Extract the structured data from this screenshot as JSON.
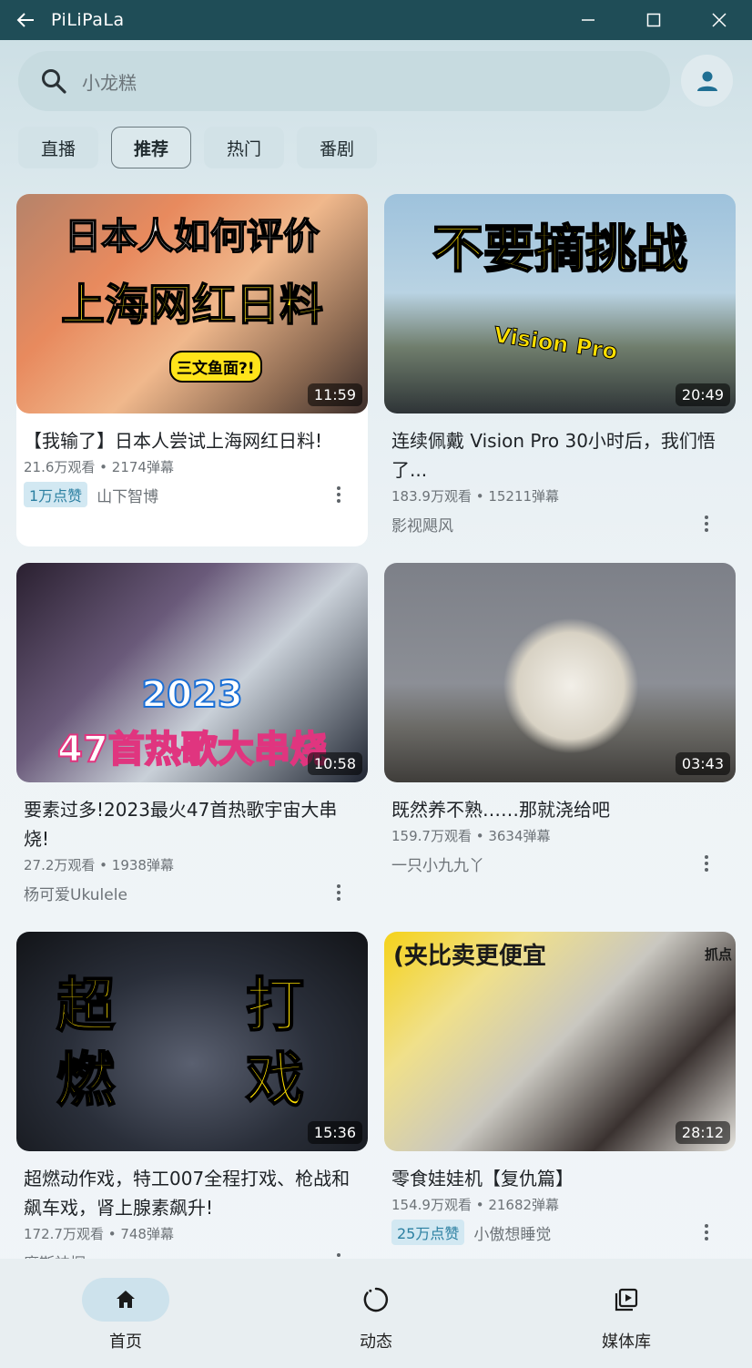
{
  "window": {
    "title": "PiLiPaLa"
  },
  "search": {
    "placeholder": "小龙糕"
  },
  "tabs": [
    {
      "label": "直播",
      "active": false
    },
    {
      "label": "推荐",
      "active": true
    },
    {
      "label": "热门",
      "active": false
    },
    {
      "label": "番剧",
      "active": false
    }
  ],
  "videos": [
    {
      "thumb_text_1": "日本人如何评价",
      "thumb_text_2": "上海网红日料",
      "thumb_text_3": "三文鱼面?!",
      "duration": "11:59",
      "title": "【我输了】日本人尝试上海网红日料!",
      "meta": "21.6万观看 • 2174弹幕",
      "likes": "1万点赞",
      "author": "山下智博"
    },
    {
      "thumb_text_1": "不要摘挑战",
      "thumb_text_2": "Vision Pro",
      "duration": "20:49",
      "title": "连续佩戴 Vision Pro 30小时后，我们悟了...",
      "meta": "183.9万观看 • 15211弹幕",
      "likes": "",
      "author": "影视飓风"
    },
    {
      "thumb_text_1": "2023",
      "thumb_text_2": "47首热歌大串烧",
      "duration": "10:58",
      "title": "要素过多!2023最火47首热歌宇宙大串烧!",
      "meta": "27.2万观看 • 1938弹幕",
      "likes": "",
      "author": "杨可爱Ukulele"
    },
    {
      "duration": "03:43",
      "title": "既然养不熟……那就浇给吧",
      "meta": "159.7万观看 • 3634弹幕",
      "likes": "",
      "author": "一只小九九丫"
    },
    {
      "thumb_text_1": "超",
      "thumb_text_2": "燃",
      "thumb_text_3": "打",
      "thumb_text_4": "戏",
      "duration": "15:36",
      "title": "超燃动作戏，特工007全程打戏、枪战和飙车戏，肾上腺素飙升!",
      "meta": "172.7万观看 • 748弹幕",
      "likes": "",
      "author": "摩斯神探"
    },
    {
      "thumb_text_1": "(夹比卖更便宜",
      "thumb_text_2": "抓点",
      "duration": "28:12",
      "title": "零食娃娃机【复仇篇】",
      "meta": "154.9万观看 • 21682弹幕",
      "likes": "25万点赞",
      "author": "小傲想睡觉"
    }
  ],
  "nav": [
    {
      "label": "首页",
      "active": true
    },
    {
      "label": "动态",
      "active": false
    },
    {
      "label": "媒体库",
      "active": false
    }
  ]
}
